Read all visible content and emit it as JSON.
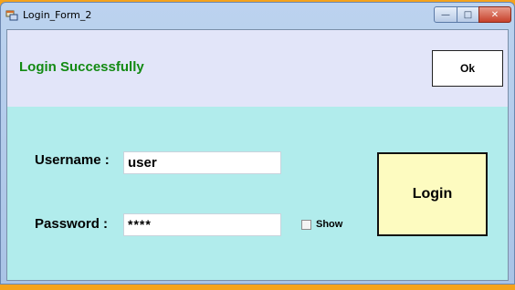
{
  "window": {
    "title": "Login_Form_2",
    "minimize_symbol": "—",
    "maximize_symbol": "□",
    "close_symbol": "✕"
  },
  "status": {
    "message": "Login Successfully",
    "color": "#138a13",
    "ok_label": "Ok"
  },
  "form": {
    "username_label": "Username :",
    "username_value": "user",
    "password_label": "Password :",
    "password_value": "****",
    "show_label": "Show",
    "show_checked": false,
    "login_label": "Login"
  },
  "colors": {
    "top_panel": "#e2e5f9",
    "main_panel": "#b1ecec",
    "login_button": "#fdfbc0",
    "background": "#f5a31c"
  }
}
